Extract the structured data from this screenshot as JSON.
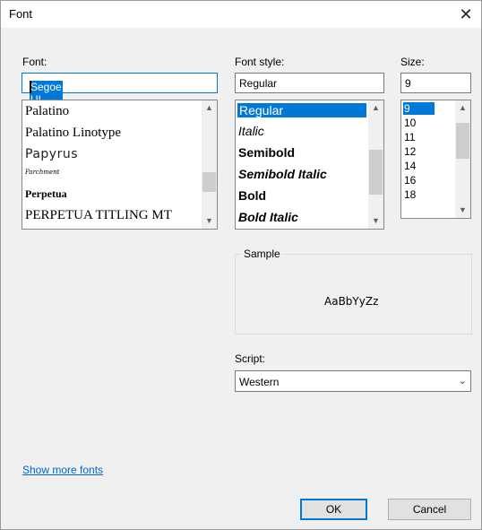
{
  "window": {
    "title": "Font",
    "close_glyph": "✕"
  },
  "font": {
    "label": "Font:",
    "value": "Segoe UI",
    "items": [
      "Palatino",
      "Palatino Linotype",
      "Papyrus",
      "Parchment",
      "Perpetua",
      "PERPETUA TITLING MT"
    ]
  },
  "style": {
    "label": "Font style:",
    "value": "Regular",
    "items": [
      "Regular",
      "Italic",
      "Semibold",
      "Semibold Italic",
      "Bold",
      "Bold Italic"
    ]
  },
  "size": {
    "label": "Size:",
    "value": "9",
    "items": [
      "9",
      "10",
      "11",
      "12",
      "14",
      "16",
      "18"
    ]
  },
  "sample": {
    "label": "Sample",
    "text": "AaBbYyZz"
  },
  "script": {
    "label": "Script:",
    "value": "Western"
  },
  "links": {
    "show_more": "Show more fonts"
  },
  "buttons": {
    "ok": "OK",
    "cancel": "Cancel"
  },
  "icons": {
    "scroll_up": "chevron-up-icon",
    "scroll_down": "chevron-down-icon",
    "combo": "chevron-down-icon"
  },
  "colors": {
    "accent": "#0078d7",
    "link": "#0066cc",
    "dialog_bg": "#f0f0f0"
  }
}
